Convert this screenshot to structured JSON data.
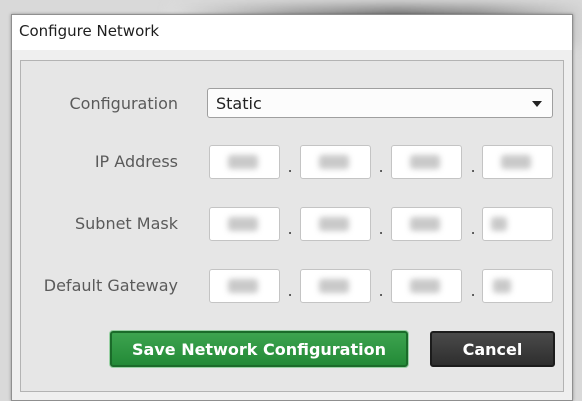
{
  "dialog": {
    "title": "Configure Network"
  },
  "form": {
    "configuration": {
      "label": "Configuration",
      "value": "Static"
    },
    "ip_address": {
      "label": "IP Address",
      "octets": [
        "",
        "",
        "",
        ""
      ]
    },
    "subnet_mask": {
      "label": "Subnet Mask",
      "octets": [
        "",
        "",
        "",
        ""
      ]
    },
    "default_gateway": {
      "label": "Default Gateway",
      "octets": [
        "",
        "",
        "",
        ""
      ]
    },
    "separator": "."
  },
  "buttons": {
    "save_label": "Save Network Configuration",
    "cancel_label": "Cancel"
  },
  "colors": {
    "save": "#238a37",
    "cancel": "#2e2e2e"
  }
}
